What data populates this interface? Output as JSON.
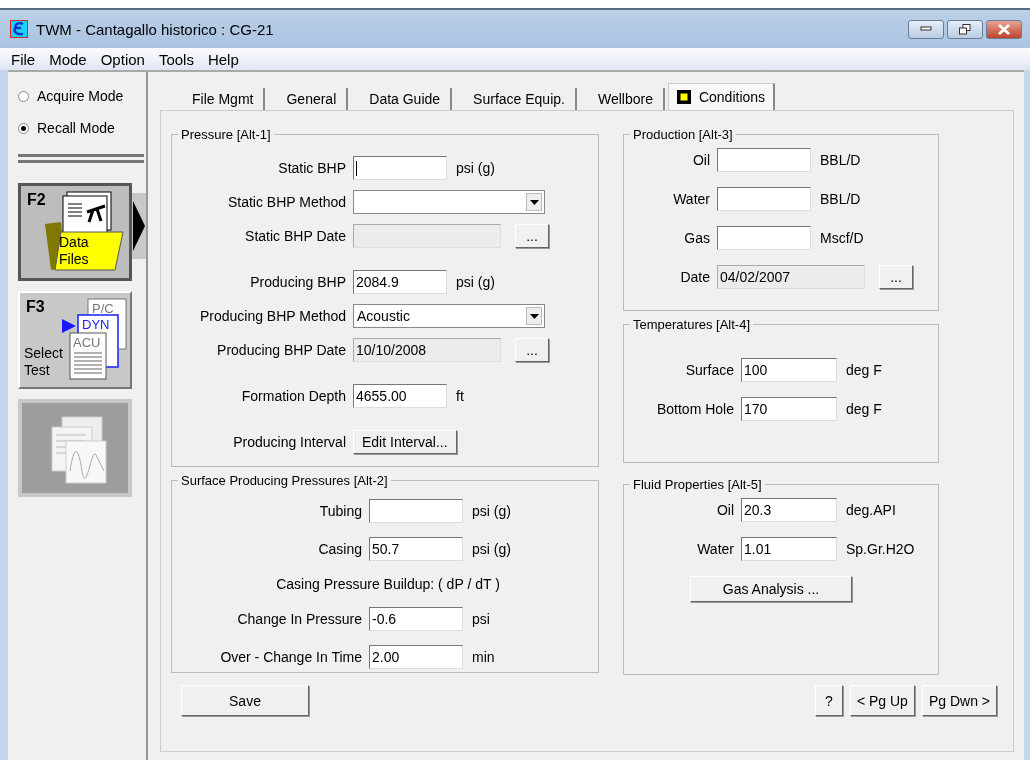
{
  "window": {
    "title": "TWM  -  Cantagallo historico : CG-21"
  },
  "menu": [
    "File",
    "Mode",
    "Option",
    "Tools",
    "Help"
  ],
  "sidebar": {
    "modes": [
      {
        "label": "Acquire Mode",
        "selected": false
      },
      {
        "label": "Recall Mode",
        "selected": true
      }
    ],
    "buttons": [
      {
        "kind": "data-files",
        "key": "F2",
        "label": "Data Files",
        "selected": true,
        "disabled": false
      },
      {
        "kind": "select-test",
        "key": "F3",
        "label": "Select Test",
        "doc_labels": [
          "P/C",
          "DYN",
          "ACU"
        ],
        "selected": false,
        "disabled": false
      },
      {
        "kind": "charts",
        "selected": false,
        "disabled": true
      }
    ]
  },
  "tabs": [
    {
      "label": "File Mgmt",
      "selected": false,
      "marker": false
    },
    {
      "label": "General",
      "selected": false,
      "marker": false
    },
    {
      "label": "Data Guide",
      "selected": false,
      "marker": false
    },
    {
      "label": "Surface Equip.",
      "selected": false,
      "marker": false
    },
    {
      "label": "Wellbore",
      "selected": false,
      "marker": false
    },
    {
      "label": "Conditions",
      "selected": true,
      "marker": true
    }
  ],
  "left_column": [
    {
      "title": "Pressure  [Alt-1]",
      "sections": [
        [
          {
            "kind": "field",
            "label": "Static BHP",
            "unit": "psi (g)",
            "focused": true
          },
          {
            "kind": "dropdown",
            "label": "Static BHP Method"
          },
          {
            "kind": "date",
            "label": "Static BHP Date",
            "button": "..."
          }
        ],
        [
          {
            "kind": "field",
            "label": "Producing BHP",
            "value": "2084.9",
            "unit": "psi (g)",
            "focused": false
          },
          {
            "kind": "dropdown",
            "label": "Producing BHP Method",
            "value": "Acoustic"
          },
          {
            "kind": "date",
            "label": "Producing BHP Date",
            "value": "10/10/2008",
            "button": "..."
          }
        ],
        [
          {
            "kind": "field",
            "label": "Formation Depth",
            "value": "4655.00",
            "unit": "ft",
            "focused": false
          }
        ],
        [
          {
            "kind": "button",
            "label": "Producing Interval",
            "button": "Edit Interval..."
          }
        ]
      ]
    },
    {
      "title": "Surface Producing Pressures [Alt-2]",
      "sections": [
        [
          {
            "kind": "field",
            "label": "Tubing",
            "unit": "psi (g)",
            "focused": false
          },
          {
            "kind": "field",
            "label": "Casing",
            "value": "50.7",
            "unit": "psi (g)",
            "focused": false
          },
          {
            "kind": "note",
            "text": "Casing Pressure Buildup:  ( dP / dT )"
          },
          {
            "kind": "field",
            "label": "Change In Pressure",
            "value": "-0.6",
            "unit": "psi",
            "focused": false
          },
          {
            "kind": "field",
            "label": "Over - Change In Time",
            "value": "2.00",
            "unit": "min",
            "focused": false
          }
        ]
      ]
    }
  ],
  "right_column": [
    {
      "title": "Production [Alt-3]",
      "sections": [
        [
          {
            "kind": "field",
            "label": "Oil",
            "unit": "BBL/D",
            "focused": false
          },
          {
            "kind": "field",
            "label": "Water",
            "unit": "BBL/D",
            "focused": false
          },
          {
            "kind": "field",
            "label": "Gas",
            "unit": "Mscf/D",
            "focused": false
          },
          {
            "kind": "date",
            "label": "Date",
            "value": "04/02/2007",
            "button": "..."
          }
        ]
      ]
    },
    {
      "title": "Temperatures [Alt-4]",
      "sections": [
        [
          {
            "kind": "field",
            "label": "Surface",
            "value": "100",
            "unit": "deg F",
            "focused": false
          },
          {
            "kind": "field",
            "label": "Bottom Hole",
            "value": "170",
            "unit": "deg F",
            "focused": false
          }
        ]
      ]
    },
    {
      "title": "Fluid Properties [Alt-5]",
      "sections": [
        [
          {
            "kind": "field",
            "label": "Oil",
            "value": "20.3",
            "unit": "deg.API",
            "focused": false
          },
          {
            "kind": "field",
            "label": "Water",
            "value": "1.01",
            "unit": "Sp.Gr.H2O",
            "focused": false
          },
          {
            "kind": "button",
            "button": "Gas Analysis ..."
          }
        ]
      ]
    }
  ],
  "footer": {
    "save": "Save",
    "nav": [
      "?",
      "< Pg Up",
      "Pg Dwn >"
    ]
  }
}
